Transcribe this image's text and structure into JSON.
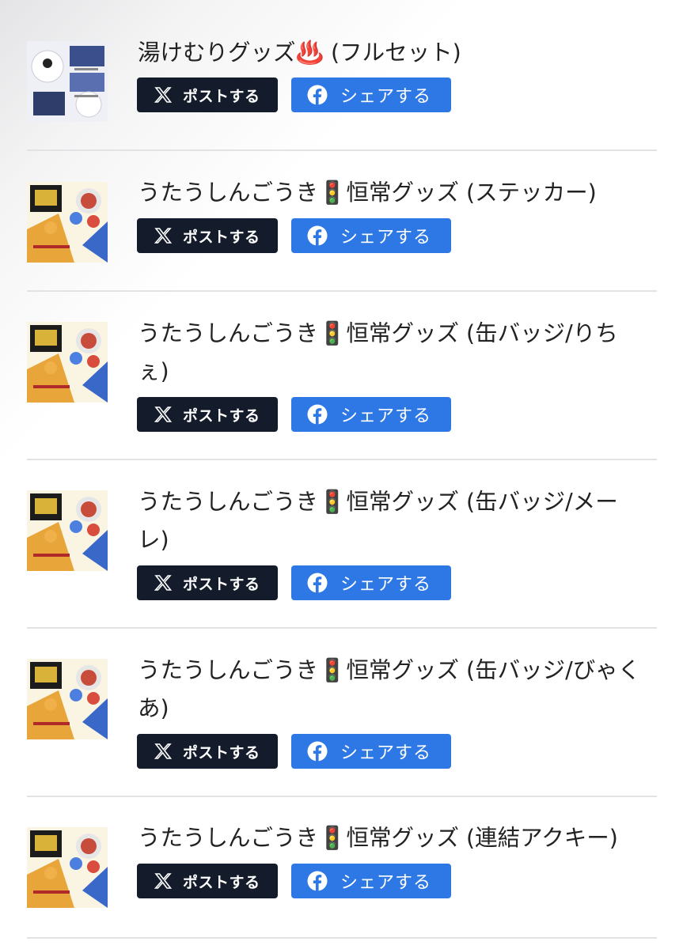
{
  "items": [
    {
      "title": "湯けむりグッズ♨️ (フルセット)",
      "thumb_icon": "goods-set-thumbnail",
      "post_label": "ポストする",
      "share_label": "シェアする"
    },
    {
      "title": "うたうしんごうき🚦恒常グッズ (ステッカー)",
      "thumb_icon": "goods-sticker-thumbnail",
      "post_label": "ポストする",
      "share_label": "シェアする"
    },
    {
      "title": "うたうしんごうき🚦恒常グッズ (缶バッジ/りちぇ)",
      "thumb_icon": "goods-badge-thumbnail",
      "post_label": "ポストする",
      "share_label": "シェアする"
    },
    {
      "title": "うたうしんごうき🚦恒常グッズ (缶バッジ/メーレ)",
      "thumb_icon": "goods-badge-thumbnail",
      "post_label": "ポストする",
      "share_label": "シェアする"
    },
    {
      "title": "うたうしんごうき🚦恒常グッズ (缶バッジ/びゃくあ)",
      "thumb_icon": "goods-badge-thumbnail",
      "post_label": "ポストする",
      "share_label": "シェアする"
    },
    {
      "title": "うたうしんごうき🚦恒常グッズ (連結アクキー)",
      "thumb_icon": "goods-keychain-thumbnail",
      "post_label": "ポストする",
      "share_label": "シェアする"
    }
  ],
  "colors": {
    "x_button": "#141c2c",
    "facebook_button": "#2e78e6",
    "divider": "#e3e3e5"
  }
}
